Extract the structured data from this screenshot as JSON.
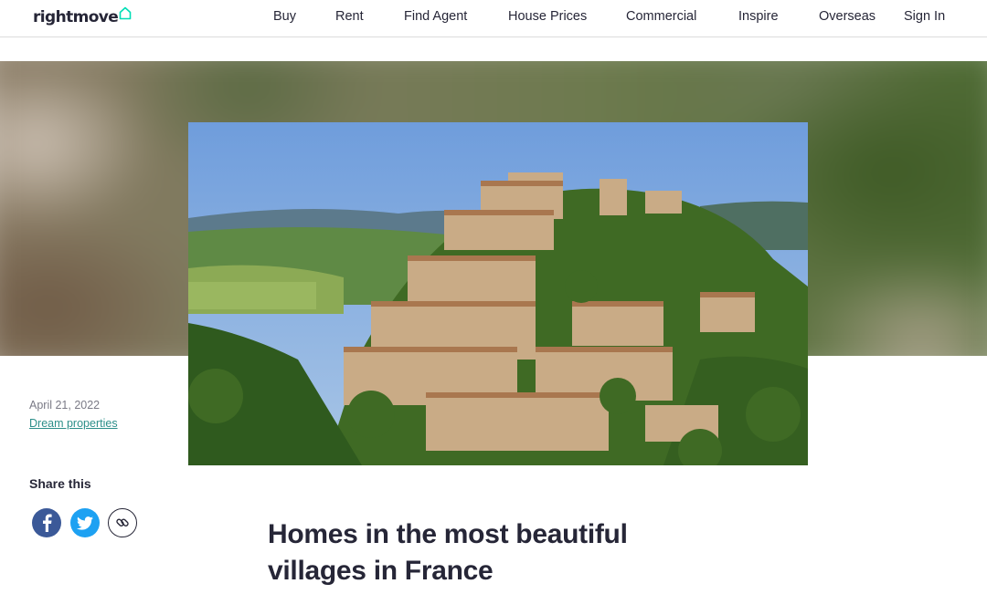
{
  "header": {
    "logo_text": "rightmove",
    "nav": [
      "Buy",
      "Rent",
      "Find Agent",
      "House Prices",
      "Commercial",
      "Inspire",
      "Overseas",
      "Sign In"
    ]
  },
  "article": {
    "date": "April 21, 2022",
    "category": "Dream properties",
    "share_label": "Share this",
    "title": "Homes in the most beautiful villages in France"
  },
  "share": [
    {
      "icon": "facebook-icon",
      "color": "#3b5998"
    },
    {
      "icon": "twitter-icon",
      "color": "#1da1f2"
    },
    {
      "icon": "link-icon",
      "color": "#262637"
    }
  ],
  "colors": {
    "brand_accent": "#00deb6",
    "text": "#262637",
    "link": "#2d8f8a"
  }
}
